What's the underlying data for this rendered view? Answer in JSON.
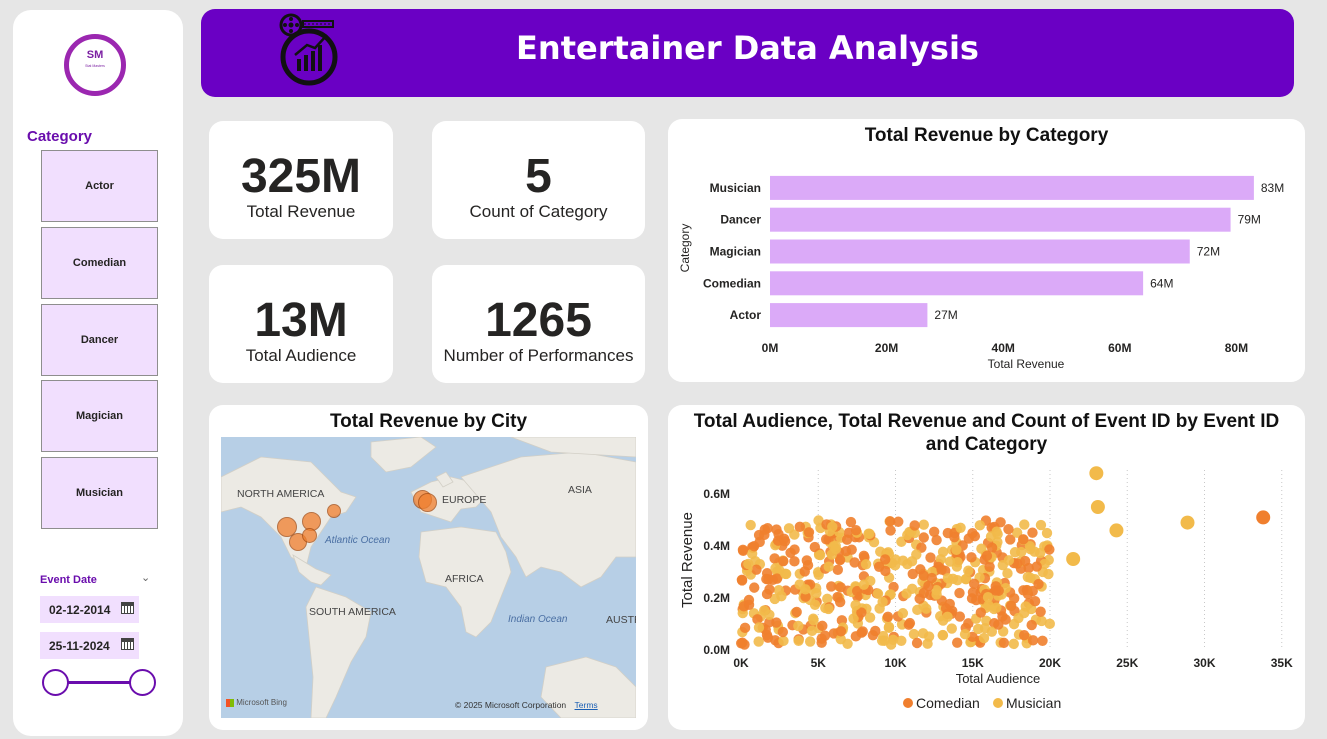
{
  "sidebar": {
    "logo_initials": "SM",
    "logo_subtext": "Stat Masters",
    "category_title": "Category",
    "categories": [
      {
        "label": "Actor"
      },
      {
        "label": "Comedian"
      },
      {
        "label": "Dancer"
      },
      {
        "label": "Magician"
      },
      {
        "label": "Musician"
      }
    ],
    "date_title": "Event Date",
    "start_date": "02-12-2014",
    "end_date": "25-11-2024"
  },
  "header": {
    "title": "Entertainer Data Analysis"
  },
  "kpis": [
    {
      "value": "325M",
      "label": "Total Revenue"
    },
    {
      "value": "5",
      "label": "Count of Category"
    },
    {
      "value": "13M",
      "label": "Total Audience"
    },
    {
      "value": "1265",
      "label": "Number of Performances"
    }
  ],
  "colors": {
    "accent": "#6a00c4",
    "bar": "#dbaaf8",
    "comedian": "#f07f2e",
    "musician": "#f2ba4a",
    "slicer_bg": "#f1dffe"
  },
  "map": {
    "title": "Total Revenue by City",
    "labels": {
      "north_america": "NORTH AMERICA",
      "europe": "EUROPE",
      "asia": "ASIA",
      "africa": "AFRICA",
      "south_america": "SOUTH AMERICA",
      "atlantic": "Atlantic Ocean",
      "indian": "Indian Ocean",
      "australia": "AUSTR"
    },
    "attribution": "Microsoft Bing",
    "copyright": "© 2025 Microsoft Corporation",
    "terms": "Terms"
  },
  "chart_data": [
    {
      "type": "bar",
      "orientation": "horizontal",
      "title": "Total Revenue by Category",
      "xlabel": "Total Revenue",
      "ylabel": "Category",
      "categories": [
        "Musician",
        "Dancer",
        "Magician",
        "Comedian",
        "Actor"
      ],
      "values": [
        83,
        79,
        72,
        64,
        27
      ],
      "data_labels": [
        "83M",
        "79M",
        "72M",
        "64M",
        "27M"
      ],
      "xticks": [
        "0M",
        "20M",
        "40M",
        "60M",
        "80M"
      ],
      "xlim": [
        0,
        90
      ],
      "grid": false
    },
    {
      "type": "scatter",
      "title": "Total Audience, Total Revenue and Count of Event ID by Event ID and Category",
      "xlabel": "Total Audience",
      "ylabel": "Total Revenue",
      "xticks": [
        "0K",
        "5K",
        "10K",
        "15K",
        "20K",
        "25K",
        "30K",
        "35K"
      ],
      "yticks": [
        "0.0M",
        "0.2M",
        "0.4M",
        "0.6M"
      ],
      "xlim": [
        0,
        35000
      ],
      "ylim": [
        0,
        0.66
      ],
      "legend_position": "bottom",
      "grid": "vertical dotted",
      "series": [
        {
          "name": "Comedian",
          "points": [
            [
              33800,
              0.51
            ]
          ]
        },
        {
          "name": "Musician",
          "points": [
            [
              23000,
              0.68
            ],
            [
              23100,
              0.55
            ],
            [
              24300,
              0.46
            ],
            [
              21500,
              0.35
            ],
            [
              28900,
              0.49
            ]
          ]
        }
      ],
      "dense_cluster": {
        "x_range": [
          0,
          20000
        ],
        "y_range": [
          0.02,
          0.5
        ],
        "approx_points": 520
      }
    }
  ]
}
